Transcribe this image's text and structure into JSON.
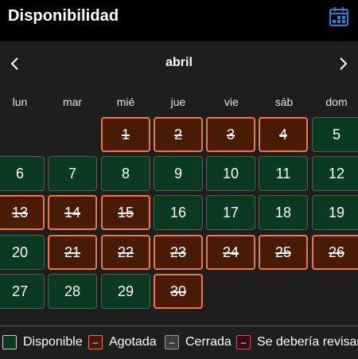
{
  "header": {
    "title": "Disponibilidad",
    "icon": "calendar-icon",
    "icon_color": "#2f7fd6"
  },
  "calendar": {
    "month": "abril",
    "prev_icon": "chevron-left-icon",
    "next_icon": "chevron-right-icon",
    "weekdays": [
      "lun",
      "mar",
      "mié",
      "jue",
      "vie",
      "sáb",
      "dom"
    ],
    "days": [
      {
        "day": "1",
        "status": "soldout"
      },
      {
        "day": "2",
        "status": "soldout"
      },
      {
        "day": "3",
        "status": "soldout"
      },
      {
        "day": "4",
        "status": "soldout"
      },
      {
        "day": "5",
        "status": "available"
      },
      {
        "day": "6",
        "status": "available"
      },
      {
        "day": "7",
        "status": "available"
      },
      {
        "day": "8",
        "status": "available"
      },
      {
        "day": "9",
        "status": "available"
      },
      {
        "day": "10",
        "status": "available"
      },
      {
        "day": "11",
        "status": "available"
      },
      {
        "day": "12",
        "status": "available"
      },
      {
        "day": "13",
        "status": "soldout"
      },
      {
        "day": "14",
        "status": "soldout"
      },
      {
        "day": "15",
        "status": "soldout"
      },
      {
        "day": "16",
        "status": "available"
      },
      {
        "day": "17",
        "status": "available"
      },
      {
        "day": "18",
        "status": "available"
      },
      {
        "day": "19",
        "status": "available"
      },
      {
        "day": "20",
        "status": "available"
      },
      {
        "day": "21",
        "status": "soldout"
      },
      {
        "day": "22",
        "status": "soldout"
      },
      {
        "day": "23",
        "status": "soldout"
      },
      {
        "day": "24",
        "status": "soldout"
      },
      {
        "day": "25",
        "status": "soldout"
      },
      {
        "day": "26",
        "status": "soldout"
      },
      {
        "day": "27",
        "status": "available"
      },
      {
        "day": "28",
        "status": "available"
      },
      {
        "day": "29",
        "status": "available"
      },
      {
        "day": "30",
        "status": "soldout"
      }
    ]
  },
  "legend": [
    {
      "label": "Disponible",
      "mark": "",
      "fill": "#0a3a1f",
      "border": "#cfcfcf"
    },
    {
      "label": "Agotada",
      "mark": "–",
      "fill": "#4a1b04",
      "border": "#f0773a"
    },
    {
      "label": "Cerrada",
      "mark": "–",
      "fill": "#3d3d3d",
      "border": "#9a9a9a"
    },
    {
      "label": "Se debería revisar",
      "mark": "–",
      "fill": "#3a0612",
      "border": "#d9486a"
    }
  ],
  "colors": {
    "available_bg": "#0a3a1f",
    "soldout_bg": "#4a1b04",
    "soldout_border": "#f0773a",
    "background": "#1e1e1e"
  }
}
